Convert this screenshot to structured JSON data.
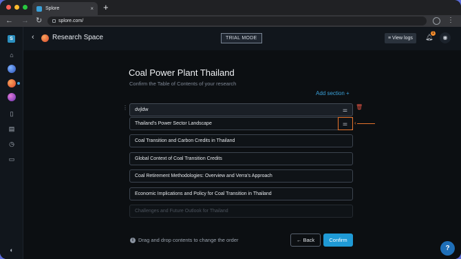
{
  "browser": {
    "tab_title": "Splore",
    "tab_close": "×",
    "new_tab": "+",
    "url": "splore.com/",
    "menu": "⋮"
  },
  "sidebar": {
    "logo": "S",
    "icons": [
      "home-icon",
      "planet-blue-icon",
      "planet-orange-icon",
      "planet-purple-icon",
      "book-icon",
      "document-icon",
      "history-icon",
      "chat-icon",
      "palette-icon"
    ]
  },
  "header": {
    "title": "Research Space",
    "trial_badge": "TRIAL MODE",
    "view_logs": "≡ View logs",
    "notification_count": "1"
  },
  "main": {
    "title": "Coal Power Plant Thailand",
    "subtitle": "Confirm the Table of Contents of your research",
    "add_section": "Add section +",
    "editing_value": "dvjldw",
    "sections": [
      "Thailand's Power Sector Landscape",
      "Coal Transition and Carbon Credits in Thailand",
      "Global Context of Coal Transition Credits",
      "Coal Retirement Methodologies: Overview and Verra's Approach",
      "Economic Implications and Policy for Coal Transition in Thailand",
      "Challenges and Future Outlook for Thailand"
    ],
    "hint": "Drag and drop contents to change the order",
    "back_button": "← Back",
    "confirm_button": "Confirm",
    "help": "?"
  },
  "colors": {
    "accent": "#1f9ad6",
    "highlight": "#e8742c",
    "delete": "#e05343"
  }
}
